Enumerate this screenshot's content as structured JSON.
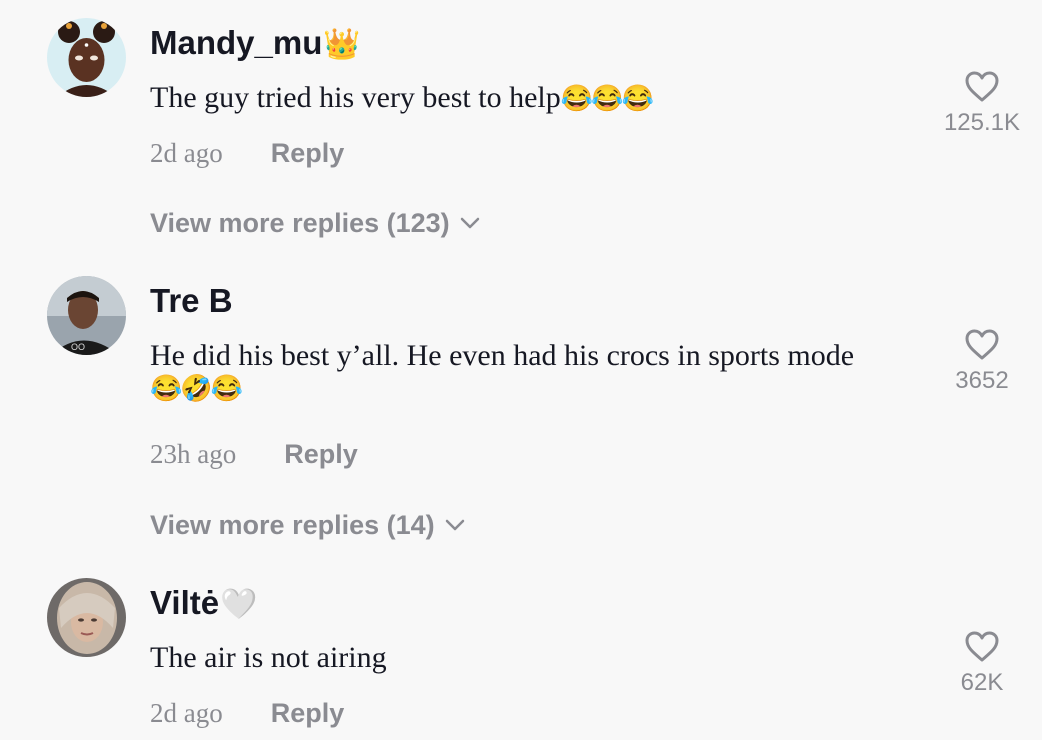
{
  "comments": [
    {
      "username": "Mandy_mu",
      "username_suffix": "👑",
      "text": "The guy tried his very best to help",
      "text_emoji": "😂😂😂",
      "time": "2d ago",
      "reply_label": "Reply",
      "like_count": "125.1K",
      "view_more": "View more replies (123)"
    },
    {
      "username": "Tre B",
      "username_suffix": "",
      "text": "He did his best y’all. He even had his crocs in sports mode",
      "text_emoji": "😂🤣😂",
      "time": "23h ago",
      "reply_label": "Reply",
      "like_count": "3652",
      "view_more": "View more replies (14)"
    },
    {
      "username": "Viltė",
      "username_suffix": "🤍",
      "text": "The air is not airing",
      "text_emoji": "",
      "time": "2d ago",
      "reply_label": "Reply",
      "like_count": "62K"
    }
  ],
  "icons": {
    "like": "heart-outline-icon",
    "expand": "chevron-down-icon"
  },
  "colors": {
    "background": "#f8f8f8",
    "username": "#161823",
    "secondary": "#8a8b91"
  }
}
